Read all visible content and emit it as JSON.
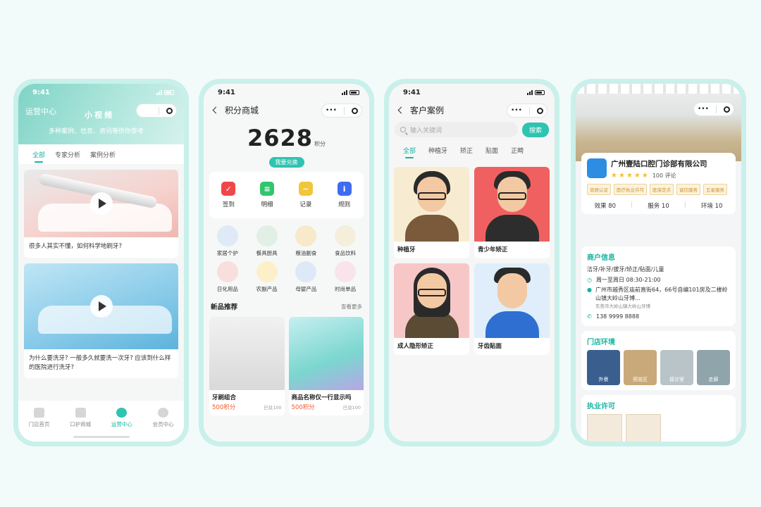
{
  "status_time": "9:41",
  "phone1": {
    "title": "运营中心",
    "banner_title": "小视频",
    "banner_sub": "多种案例、信息、资讯等供你参考",
    "tabs": [
      "全部",
      "专家分析",
      "案例分析"
    ],
    "videos": [
      {
        "caption": "很多人其实不懂，如何科学地刷牙?"
      },
      {
        "caption": "为什么要洗牙? 一般多久就要洗一次牙? 应该到什么样的医院进行洗牙?"
      }
    ],
    "tabbar": [
      "门店首页",
      "口护商城",
      "运营中心",
      "会员中心"
    ]
  },
  "phone2": {
    "title": "积分商城",
    "points": "2628",
    "points_unit": "积分",
    "redeem": "我要兑换",
    "quick": [
      {
        "label": "签到",
        "color": "#f0474a",
        "glyph": "✓"
      },
      {
        "label": "明细",
        "color": "#33c46e",
        "glyph": "≡"
      },
      {
        "label": "记录",
        "color": "#f2c63b",
        "glyph": "~"
      },
      {
        "label": "规则",
        "color": "#3f6bf2",
        "glyph": "i"
      }
    ],
    "categories": [
      {
        "label": "家居个护",
        "color": "#dfeaf6"
      },
      {
        "label": "餐具厨具",
        "color": "#e1efe4"
      },
      {
        "label": "粮油副食",
        "color": "#f7e9c9"
      },
      {
        "label": "食品饮料",
        "color": "#f4eedb"
      },
      {
        "label": "日化用品",
        "color": "#f9dede"
      },
      {
        "label": "农副产品",
        "color": "#fbf0c7"
      },
      {
        "label": "母婴产品",
        "color": "#dde9f7"
      },
      {
        "label": "时尚单品",
        "color": "#f8e4ea"
      }
    ],
    "new_title": "新品推荐",
    "new_more": "查看更多",
    "products": [
      {
        "name": "牙刷组合",
        "price": "500积分",
        "sold": "已兑100"
      },
      {
        "name": "商品名称仅一行显示吗",
        "price": "500积分",
        "sold": "已兑100"
      }
    ]
  },
  "phone3": {
    "title": "客户案例",
    "search_placeholder": "输入关键词",
    "search_btn": "搜索",
    "tabs": [
      "全部",
      "种植牙",
      "矫正",
      "贴面",
      "正畸"
    ],
    "cases": [
      {
        "label": "种植牙",
        "bg": "#f7ecd2",
        "shirt": "#7b5a3c"
      },
      {
        "label": "青少年矫正",
        "bg": "#f06060",
        "shirt": "#2d2d2d"
      },
      {
        "label": "成人隐形矫正",
        "bg": "#f7c7c8",
        "shirt": "#5b4a34"
      },
      {
        "label": "牙齿贴面",
        "bg": "#dfeefa",
        "shirt": "#2f6fd1"
      }
    ]
  },
  "phone4": {
    "name": "广州壹陆口腔门诊部有限公司",
    "reviews": "100 评论",
    "badges": [
      "资质认证",
      "医疗执业许可",
      "医保定点",
      "诚信服务",
      "五星服务"
    ],
    "stats": [
      "效果 80",
      "服务 10",
      "环境 10"
    ],
    "info_title": "商户信息",
    "services": "洁牙/补牙/拔牙/矫正/贴面/儿童",
    "hours": "周一至周日 08:30-21:00",
    "address": "广州市越秀区庙前直街64，66号自编101房及二楼岭山镇大岭山牙博...",
    "address_sub": "东莞市大岭山镇大岭山牙博",
    "phone": "138 9999 8888",
    "env_title": "门店环境",
    "env": [
      {
        "label": "外景",
        "color": "#3a5f8f"
      },
      {
        "label": "预览区",
        "color": "#c9a87a"
      },
      {
        "label": "接诊室",
        "color": "#b8c4c8"
      },
      {
        "label": "走廊",
        "color": "#8fa4ab"
      }
    ],
    "license_title": "执业许可"
  }
}
